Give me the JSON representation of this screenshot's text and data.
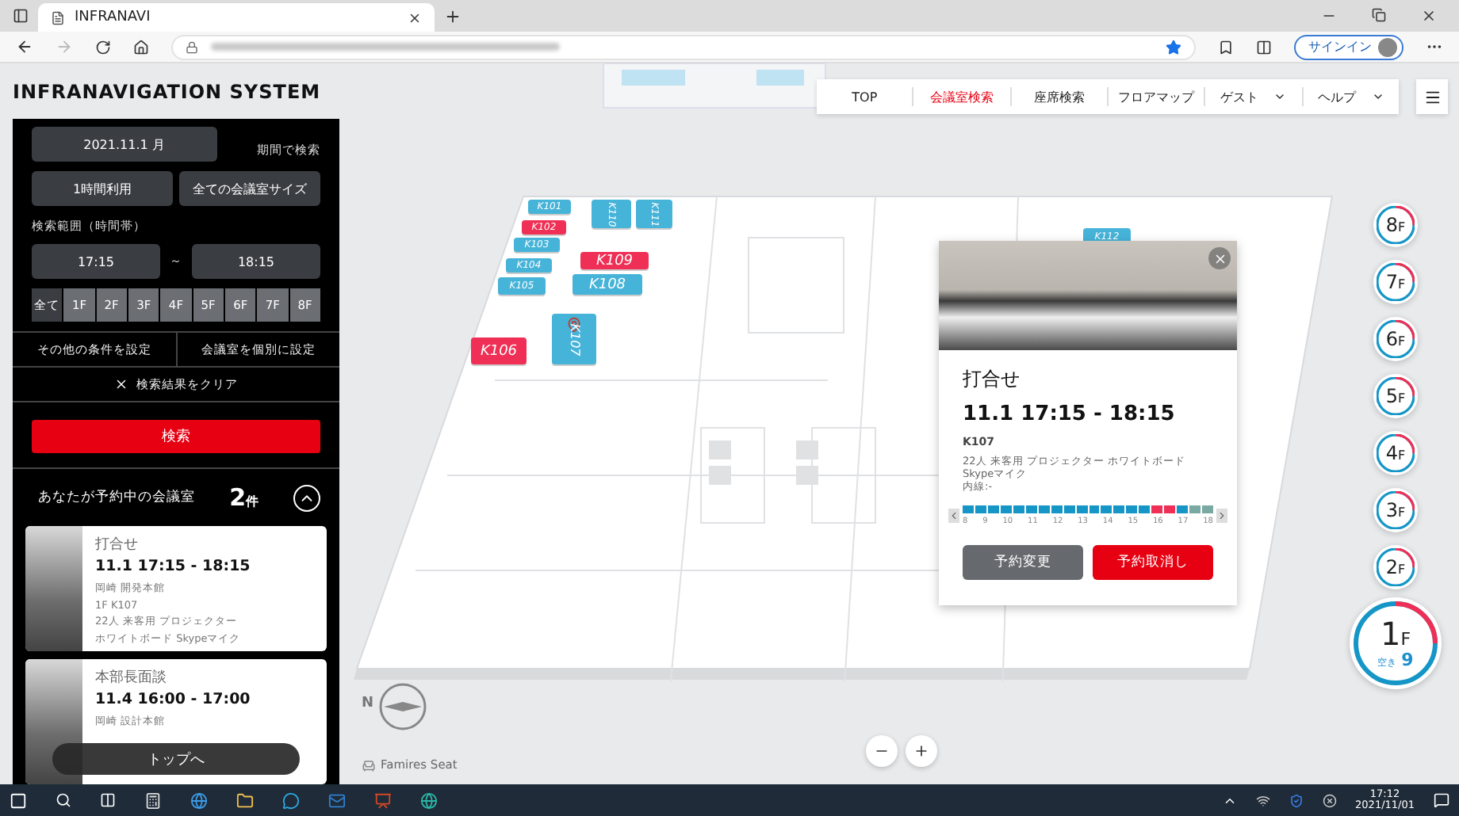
{
  "browser": {
    "tab_title": "INFRANAVI",
    "sign_in": "サインイン"
  },
  "app_title": "INFRANAVIGATION SYSTEM",
  "nav": [
    {
      "label": "TOP",
      "selected": false,
      "dropdown": false
    },
    {
      "label": "会議室検索",
      "selected": true,
      "dropdown": false
    },
    {
      "label": "座席検索",
      "selected": false,
      "dropdown": false
    },
    {
      "label": "フロアマップ",
      "selected": false,
      "dropdown": false
    },
    {
      "label": "ゲスト",
      "selected": false,
      "dropdown": true
    },
    {
      "label": "ヘルプ",
      "selected": false,
      "dropdown": true
    }
  ],
  "search": {
    "date": "2021.11.1 月",
    "period_link": "期間で検索",
    "duration": "1時間利用",
    "room_size": "全ての会議室サイズ",
    "range_label": "検索範囲（時間帯）",
    "start_time": "17:15",
    "separator": "～",
    "end_time": "18:15",
    "floors": [
      {
        "label": "全て",
        "selected": true
      },
      {
        "label": "1F",
        "selected": false
      },
      {
        "label": "2F",
        "selected": false
      },
      {
        "label": "3F",
        "selected": false
      },
      {
        "label": "4F",
        "selected": false
      },
      {
        "label": "5F",
        "selected": false
      },
      {
        "label": "6F",
        "selected": false
      },
      {
        "label": "7F",
        "selected": false
      },
      {
        "label": "8F",
        "selected": false
      }
    ],
    "other_conditions": "その他の条件を設定",
    "individual_rooms": "会議室を個別に設定",
    "clear": "検索結果をクリア",
    "submit": "検索"
  },
  "reservations": {
    "title": "あなたが予約中の会議室",
    "count": "2",
    "count_unit": "件",
    "expanded": true,
    "to_top": "トップへ",
    "items": [
      {
        "name": "打合せ",
        "time": "11.1 17:15 - 18:15",
        "details": [
          "岡崎 開発本館",
          "1F K107",
          "22人 来客用 プロジェクター",
          "ホワイトボード Skypeマイク"
        ]
      },
      {
        "name": "本部長面談",
        "time": "11.4 16:00 - 17:00",
        "details": [
          "岡崎 設計本館"
        ]
      }
    ]
  },
  "map": {
    "compass_label": "N",
    "seat_label": "Famires Seat",
    "rooms": [
      {
        "label": "K101",
        "color": "#46b3d8",
        "vertical": false,
        "pinned": false
      },
      {
        "label": "K102",
        "color": "#ef2f55",
        "vertical": false,
        "pinned": false
      },
      {
        "label": "K103",
        "color": "#46b3d8",
        "vertical": false,
        "pinned": false
      },
      {
        "label": "K104",
        "color": "#46b3d8",
        "vertical": false,
        "pinned": false
      },
      {
        "label": "K105",
        "color": "#46b3d8",
        "vertical": false,
        "pinned": false
      },
      {
        "label": "K106",
        "color": "#ef2f55",
        "vertical": false,
        "pinned": false
      },
      {
        "label": "K107",
        "color": "#46b3d8",
        "vertical": true,
        "pinned": true
      },
      {
        "label": "K108",
        "color": "#46b3d8",
        "vertical": false,
        "pinned": false
      },
      {
        "label": "K109",
        "color": "#ef2f55",
        "vertical": false,
        "pinned": false
      },
      {
        "label": "K110",
        "color": "#46b3d8",
        "vertical": true,
        "pinned": false
      },
      {
        "label": "K111",
        "color": "#46b3d8",
        "vertical": true,
        "pinned": false
      },
      {
        "label": "K112",
        "color": "#46b3d8",
        "vertical": false,
        "pinned": false
      }
    ]
  },
  "floors": [
    {
      "number": "8",
      "unit": "F",
      "selected": false
    },
    {
      "number": "7",
      "unit": "F",
      "selected": false
    },
    {
      "number": "6",
      "unit": "F",
      "selected": false
    },
    {
      "number": "5",
      "unit": "F",
      "selected": false
    },
    {
      "number": "4",
      "unit": "F",
      "selected": false
    },
    {
      "number": "3",
      "unit": "F",
      "selected": false
    },
    {
      "number": "2",
      "unit": "F",
      "selected": false
    },
    {
      "number": "1",
      "unit": "F",
      "selected": true,
      "vacant_label": "空き",
      "vacant_count": "9"
    }
  ],
  "popup": {
    "title": "打合せ",
    "time": "11.1 17:15 - 18:15",
    "room": "K107",
    "equipment": "22人 来客用 プロジェクター ホワイトボード Skypeマイク",
    "extension": "内線:-",
    "hours": [
      "8",
      "9",
      "10",
      "11",
      "12",
      "13",
      "14",
      "15",
      "16",
      "17",
      "18"
    ],
    "slots": [
      {
        "kind": "free"
      },
      {
        "kind": "free"
      },
      {
        "kind": "free"
      },
      {
        "kind": "free"
      },
      {
        "kind": "free"
      },
      {
        "kind": "free"
      },
      {
        "kind": "free"
      },
      {
        "kind": "free"
      },
      {
        "kind": "free"
      },
      {
        "kind": "free"
      },
      {
        "kind": "free"
      },
      {
        "kind": "free"
      },
      {
        "kind": "free"
      },
      {
        "kind": "free"
      },
      {
        "kind": "free"
      },
      {
        "kind": "reserved"
      },
      {
        "kind": "reserved"
      },
      {
        "kind": "free"
      },
      {
        "kind": "unavailable"
      },
      {
        "kind": "unavailable"
      }
    ],
    "buttons": [
      {
        "label": "予約変更",
        "kind": "secondary"
      },
      {
        "label": "予約取消し",
        "kind": "danger"
      }
    ]
  },
  "taskbar": {
    "time": "17:12",
    "date": "2021/11/01"
  }
}
